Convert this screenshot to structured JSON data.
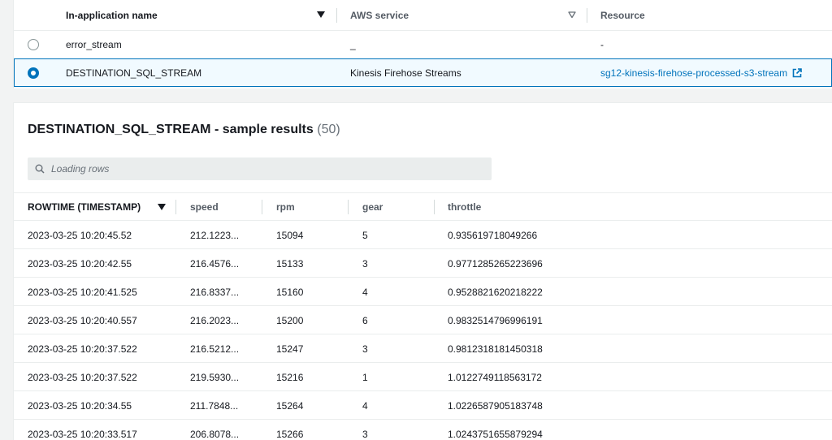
{
  "streams_table": {
    "columns": {
      "name": "In-application name",
      "service": "AWS service",
      "resource": "Resource"
    },
    "rows": [
      {
        "name": "error_stream",
        "service": "_",
        "resource": "-",
        "selected": false
      },
      {
        "name": "DESTINATION_SQL_STREAM",
        "service": "Kinesis Firehose Streams",
        "resource": "sg12-kinesis-firehose-processed-s3-stream",
        "selected": true
      }
    ],
    "icons": {
      "sort": "caret-down-icon",
      "filter": "caret-outline-down-icon",
      "external": "external-link-icon"
    }
  },
  "results": {
    "title": "DESTINATION_SQL_STREAM - sample results",
    "count": "(50)",
    "search": {
      "placeholder": "Loading rows",
      "icon": "search-icon"
    },
    "columns": {
      "rowtime": "ROWTIME (TIMESTAMP)",
      "speed": "speed",
      "rpm": "rpm",
      "gear": "gear",
      "throttle": "throttle"
    },
    "rows": [
      {
        "rowtime": "2023-03-25 10:20:45.52",
        "speed": "212.1223...",
        "rpm": "15094",
        "gear": "5",
        "throttle": "0.935619718049266"
      },
      {
        "rowtime": "2023-03-25 10:20:42.55",
        "speed": "216.4576...",
        "rpm": "15133",
        "gear": "3",
        "throttle": "0.9771285265223696"
      },
      {
        "rowtime": "2023-03-25 10:20:41.525",
        "speed": "216.8337...",
        "rpm": "15160",
        "gear": "4",
        "throttle": "0.9528821620218222"
      },
      {
        "rowtime": "2023-03-25 10:20:40.557",
        "speed": "216.2023...",
        "rpm": "15200",
        "gear": "6",
        "throttle": "0.9832514796996191"
      },
      {
        "rowtime": "2023-03-25 10:20:37.522",
        "speed": "216.5212...",
        "rpm": "15247",
        "gear": "3",
        "throttle": "0.9812318181450318"
      },
      {
        "rowtime": "2023-03-25 10:20:37.522",
        "speed": "219.5930...",
        "rpm": "15216",
        "gear": "1",
        "throttle": "1.0122749118563172"
      },
      {
        "rowtime": "2023-03-25 10:20:34.55",
        "speed": "211.7848...",
        "rpm": "15264",
        "gear": "4",
        "throttle": "1.0226587905183748"
      },
      {
        "rowtime": "2023-03-25 10:20:33.517",
        "speed": "206.8078...",
        "rpm": "15266",
        "gear": "3",
        "throttle": "1.0243751655879294"
      }
    ]
  },
  "colors": {
    "accent": "#0073bb",
    "selected_row_bg": "#f1faff",
    "page_bg": "#f2f3f3"
  }
}
